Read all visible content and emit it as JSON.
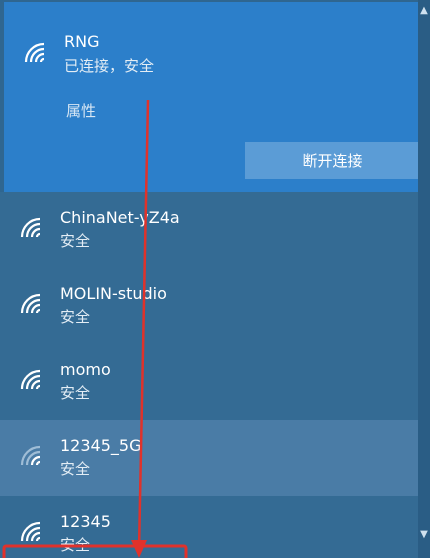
{
  "connected": {
    "name": "RNG",
    "status": "已连接，安全",
    "properties_label": "属性",
    "disconnect_label": "断开连接"
  },
  "networks": [
    {
      "name": "ChinaNet-yZ4a",
      "status": "安全"
    },
    {
      "name": "MOLIN-studio",
      "status": "安全"
    },
    {
      "name": "momo",
      "status": "安全"
    },
    {
      "name": "12345_5G",
      "status": "安全"
    },
    {
      "name": "12345",
      "status": "安全"
    }
  ],
  "icons": {
    "wifi": "wifi-signal-icon",
    "scroll_up": "▲",
    "scroll_down": "▼"
  },
  "colors": {
    "connected_bg": "#2c7fca",
    "list_bg": "#346b94",
    "annotation_red": "#e0322b"
  }
}
